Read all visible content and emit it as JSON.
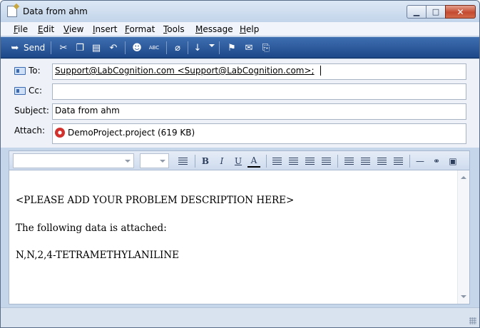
{
  "window": {
    "title": "Data from ahm",
    "minimize": "▁",
    "maximize": "□",
    "close": "✕"
  },
  "menu": [
    {
      "u": "F",
      "rest": "ile"
    },
    {
      "u": "E",
      "rest": "dit"
    },
    {
      "u": "V",
      "rest": "iew"
    },
    {
      "u": "I",
      "rest": "nsert"
    },
    {
      "u": "F",
      "rest": "ormat"
    },
    {
      "u": "T",
      "rest": "ools"
    },
    {
      "u": "M",
      "rest": "essage"
    },
    {
      "u": "H",
      "rest": "elp"
    }
  ],
  "toolbar": {
    "send_label": "Send",
    "send_glyph": "➥",
    "cut_glyph": "✂",
    "copy_glyph": "❐",
    "paste_glyph": "▤",
    "undo_glyph": "↶",
    "check_names_glyph": "☻",
    "spelling_glyph": "✓",
    "attach_glyph": "⌀",
    "priority_glyph": "↓",
    "flag_glyph": "⚑",
    "encrypt_glyph": "✉",
    "offline_glyph": "⎘",
    "spelling_text": "ABC"
  },
  "fields": {
    "to_label": "To:",
    "to_value": "Support@LabCognition.com <Support@LabCognition.com>;",
    "cc_label": "Cc:",
    "cc_value": "",
    "subject_label": "Subject:",
    "subject_value": "Data from ahm",
    "attach_label": "Attach:",
    "attach_value": "DemoProject.project (619 KB)"
  },
  "format": {
    "font_name": "",
    "font_size": "",
    "bold": "B",
    "italic": "I",
    "underline": "U",
    "font_color": "A",
    "align_glyph": "≡",
    "hr_glyph": "—",
    "link_glyph": "⚭",
    "picture_glyph": "▣"
  },
  "body": {
    "line1": "<PLEASE ADD YOUR PROBLEM DESCRIPTION HERE>",
    "line2": "The following data is attached:",
    "line3": "N,N,2,4-TETRAMETHYLANILINE"
  }
}
